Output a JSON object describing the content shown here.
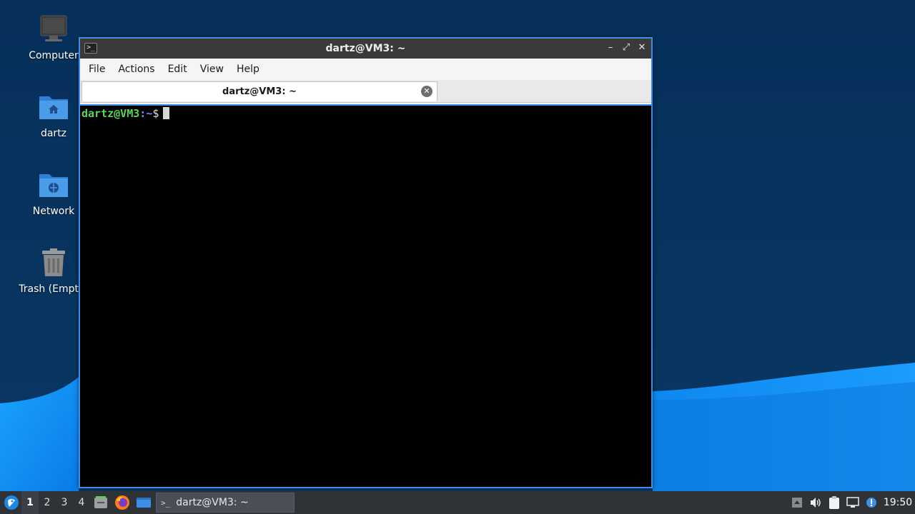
{
  "desktop": {
    "icons": [
      {
        "label": "Computer"
      },
      {
        "label": "dartz"
      },
      {
        "label": "Network"
      },
      {
        "label": "Trash (Empty)"
      }
    ]
  },
  "window": {
    "title": "dartz@VM3: ~",
    "menu": [
      "File",
      "Actions",
      "Edit",
      "View",
      "Help"
    ],
    "tab_title": "dartz@VM3: ~",
    "prompt": {
      "user_host": "dartz@VM3",
      "colon": ":",
      "path": "~",
      "symbol": "$"
    }
  },
  "taskbar": {
    "workspaces": [
      "1",
      "2",
      "3",
      "4"
    ],
    "active_workspace": "1",
    "task_title": "dartz@VM3: ~",
    "clock": "19:50"
  },
  "colors": {
    "accent": "#3d8ee6",
    "prompt_user": "#5fd35f",
    "prompt_path": "#6f8fff",
    "taskbar": "#2f3236"
  }
}
